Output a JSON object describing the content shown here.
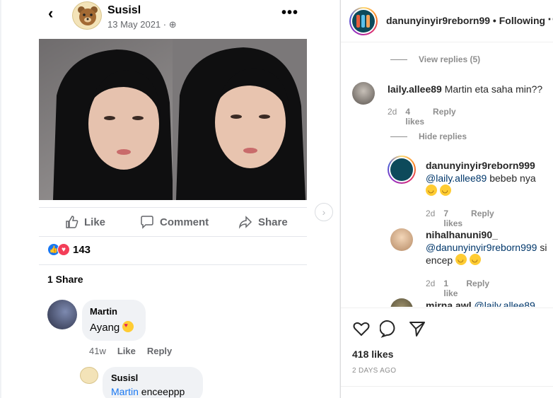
{
  "fb_post": {
    "author": "Susisl",
    "date": "13 May 2021 · ",
    "actions": {
      "like": "Like",
      "comment": "Comment",
      "share": "Share"
    },
    "reactions_count": "143",
    "shares": "1 Share",
    "comments": [
      {
        "author": "Martin",
        "text": "Ayang ",
        "time": "41w",
        "like": "Like",
        "reply": "Reply"
      },
      {
        "author": "Susisl",
        "mention": "Martin",
        "text": " enceeppp"
      }
    ]
  },
  "ig": {
    "username": "danunyinyir9reborn99",
    "separator": " • ",
    "follow_state": "Following",
    "thread": {
      "view_replies": "View replies (5)",
      "hide_replies": "Hide replies",
      "comments": [
        {
          "user": "laily.allee89",
          "text": "Martin eta saha min??",
          "time": "2d",
          "likes": "4 likes",
          "reply": "Reply"
        },
        {
          "user": "danunyinyir9reborn999",
          "mention": "@laily.allee89",
          "text": " bebeb nya",
          "time": "2d",
          "likes": "7 likes",
          "reply": "Reply"
        },
        {
          "user": "nihalhanuni90_",
          "mention": "@danunyinyir9reborn999",
          "text": " si encep",
          "time": "2d",
          "likes": "1 like",
          "reply": "Reply"
        },
        {
          "user": "mirna.awl",
          "mention": "@laily.allee89"
        }
      ]
    },
    "likes": "418 likes",
    "posted": "2 DAYS AGO"
  },
  "colors": {
    "fb_blue": "#1877f2",
    "love_red": "#f33e58",
    "ig_mention": "#00376b",
    "ig_meta": "#8e8e8e"
  }
}
